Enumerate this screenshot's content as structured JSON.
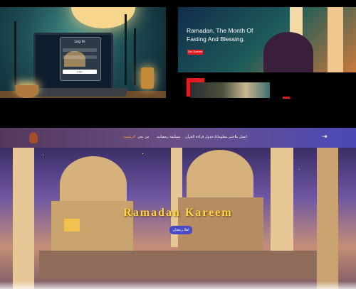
{
  "panel_laptop": {
    "login_title": "Log In",
    "login_button": "Login"
  },
  "panel_hero": {
    "title_line1": "Ramadan, The Month Of",
    "title_line2": "Fasting And Blessing.",
    "button": "Get Started"
  },
  "navbar": {
    "items": [
      {
        "label": "الرئيسية",
        "active": true
      },
      {
        "label": "من نحن",
        "active": false
      },
      {
        "label": "مسابقة رمضانية",
        "active": false
      },
      {
        "label": "جدول قراءة القرآن",
        "active": false
      },
      {
        "label": "اختبر معلوماتك",
        "active": false
      },
      {
        "label": "اتصل بنا",
        "active": false
      }
    ],
    "login_icon": "login-icon"
  },
  "hero": {
    "heading": "Ramadan Kareem",
    "button": "اهلا رمضان"
  },
  "colors": {
    "accent_red": "#e01b22",
    "nav_active": "#f2a642",
    "heading_gold": "#ffd34a",
    "button_blue": "#4a4ac7"
  }
}
